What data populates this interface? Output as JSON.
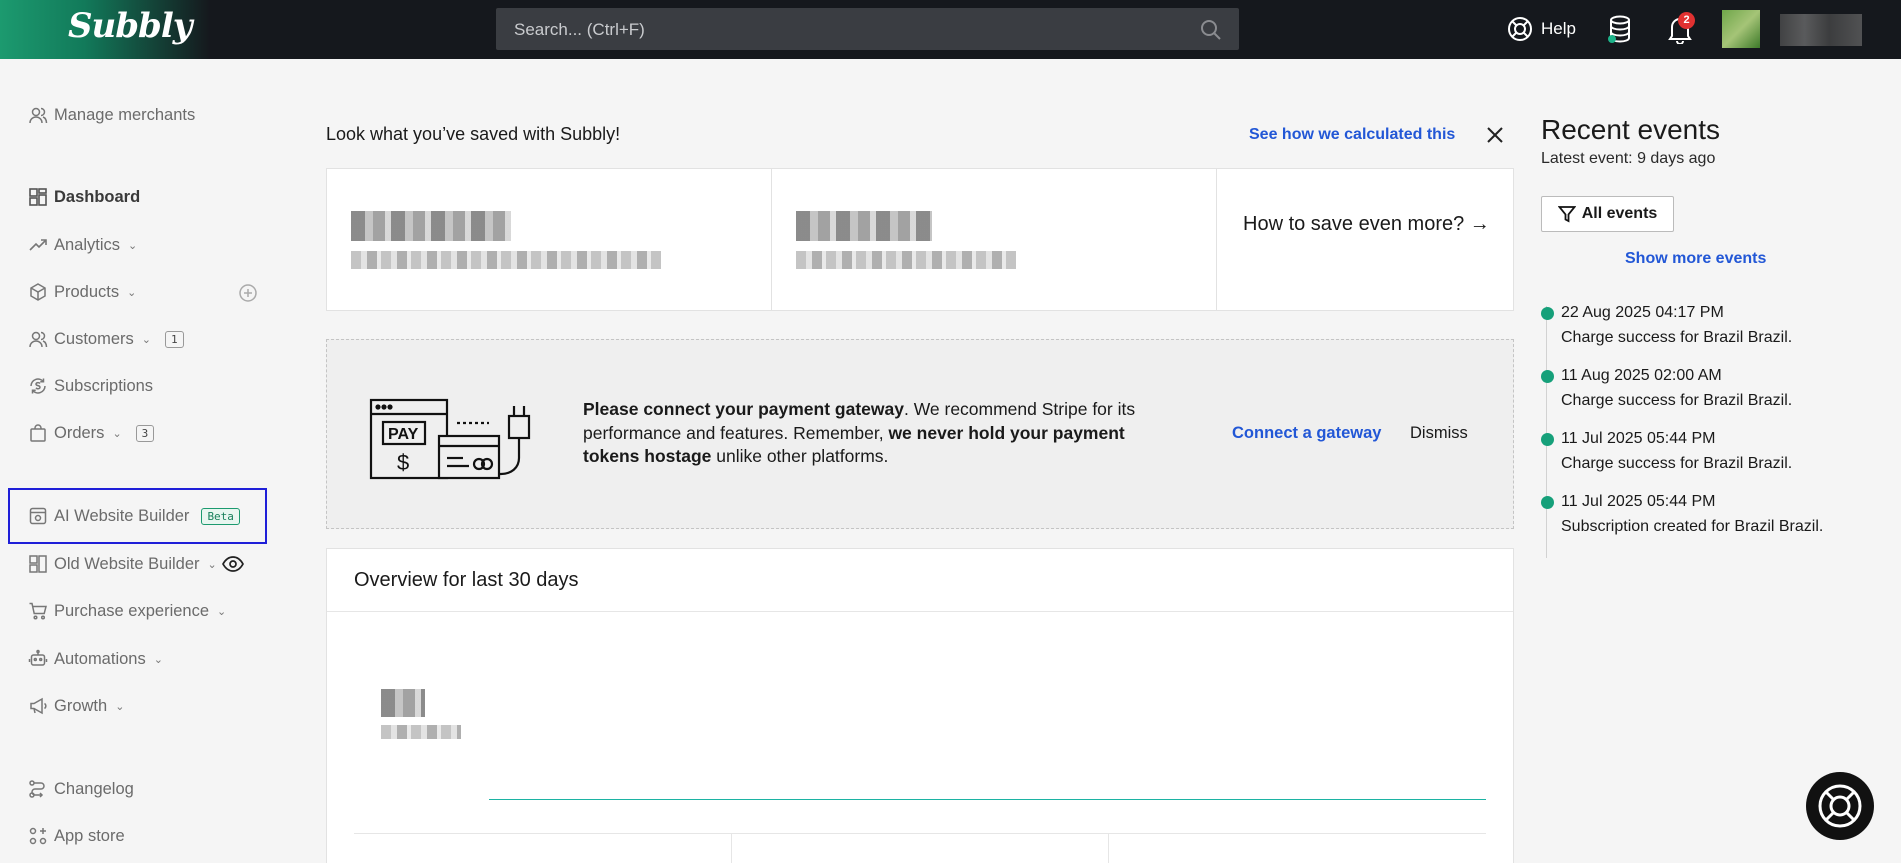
{
  "header": {
    "logo": "Subbly",
    "search_placeholder": "Search... (Ctrl+F)",
    "help_label": "Help",
    "notification_count": "2"
  },
  "sidebar": {
    "manage_merchants": "Manage merchants",
    "items": [
      {
        "label": "Dashboard"
      },
      {
        "label": "Analytics"
      },
      {
        "label": "Products"
      },
      {
        "label": "Customers",
        "count": "1"
      },
      {
        "label": "Subscriptions"
      },
      {
        "label": "Orders",
        "count": "3"
      },
      {
        "label": "AI Website Builder",
        "badge": "Beta"
      },
      {
        "label": "Old Website Builder"
      },
      {
        "label": "Purchase experience"
      },
      {
        "label": "Automations"
      },
      {
        "label": "Growth"
      },
      {
        "label": "Changelog"
      },
      {
        "label": "App store"
      }
    ]
  },
  "savings": {
    "title": "Look what you’ve saved with Subbly!",
    "calc_link": "See how we calculated this",
    "save_more": "How to save even more? →"
  },
  "gateway": {
    "bold1": "Please connect your payment gateway",
    "text1": ". We recommend Stripe for its performance and features. Remember, ",
    "bold2": "we never hold your payment tokens hostage",
    "text2": " unlike other platforms.",
    "connect_label": "Connect a gateway",
    "dismiss_label": "Dismiss"
  },
  "overview": {
    "title": "Overview for last 30 days"
  },
  "events": {
    "title": "Recent events",
    "latest": "Latest event: 9 days ago",
    "filter_label": "All events",
    "show_more": "Show more events",
    "list": [
      {
        "time": "22 Aug 2025 04:17 PM",
        "desc": "Charge success for Brazil Brazil."
      },
      {
        "time": "11 Aug 2025 02:00 AM",
        "desc": "Charge success for Brazil Brazil."
      },
      {
        "time": "11 Jul 2025 05:44 PM",
        "desc": "Charge success for Brazil Brazil."
      },
      {
        "time": "11 Jul 2025 05:44 PM",
        "desc": "Subscription created for Brazil Brazil."
      }
    ]
  },
  "colors": {
    "accent": "#1c9a6f",
    "link": "#2257d6",
    "topbar": "#15181d",
    "highlight_box": "#1f1fd8"
  }
}
